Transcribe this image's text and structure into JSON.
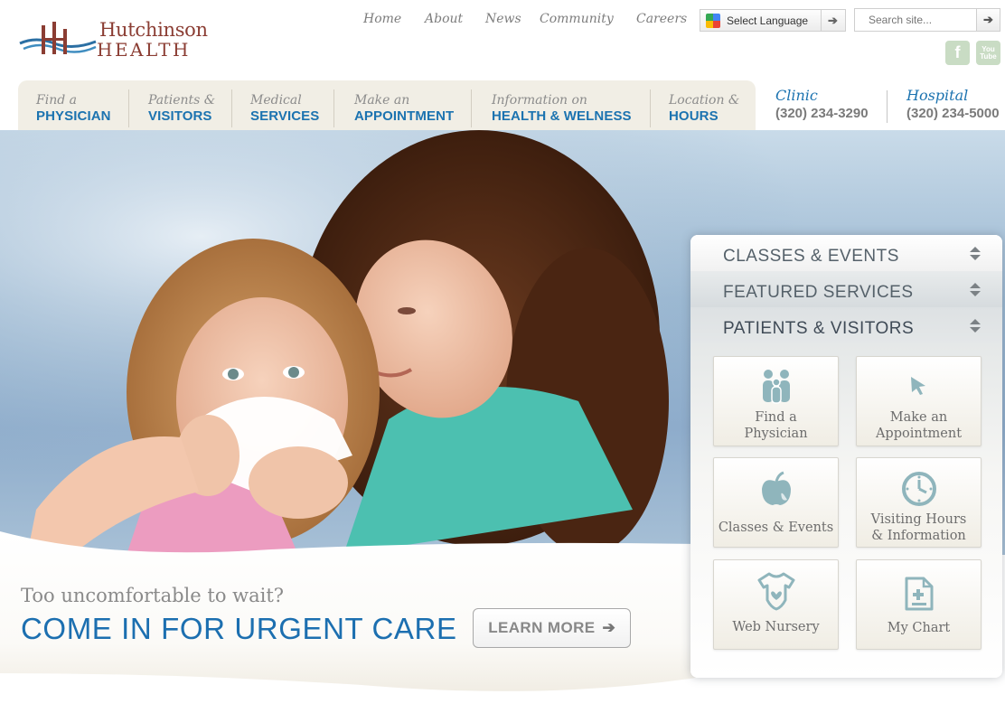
{
  "brand": {
    "name_top": "Hutchinson",
    "name_bottom": "HEALTH"
  },
  "top_nav": [
    "Home",
    "About",
    "News",
    "Community",
    "Careers"
  ],
  "language": {
    "label": "Select Language"
  },
  "search": {
    "placeholder": "Search site..."
  },
  "social": {
    "facebook": "f",
    "youtube_top": "You",
    "youtube_bottom": "Tube"
  },
  "main_nav": [
    {
      "small": "Find a",
      "big": "PHYSICIAN"
    },
    {
      "small": "Patients &",
      "big": "VISITORS"
    },
    {
      "small": "Medical",
      "big": "SERVICES"
    },
    {
      "small": "Make an",
      "big": "APPOINTMENT"
    },
    {
      "small": "Information on",
      "big": "HEALTH & WELNESS"
    },
    {
      "small": "Location &",
      "big": "HOURS"
    }
  ],
  "phones": [
    {
      "label": "Clinic",
      "number": "(320) 234-3290"
    },
    {
      "label": "Hospital",
      "number": "(320) 234-5000"
    }
  ],
  "promo": {
    "question": "Too uncomfortable to wait?",
    "title": "COME IN FOR URGENT CARE",
    "button": "LEARN MORE"
  },
  "panel": {
    "sections": [
      "CLASSES & EVENTS",
      "FEATURED SERVICES",
      "PATIENTS & VISITORS"
    ],
    "tiles": [
      {
        "label_1": "Find a",
        "label_2": "Physician",
        "icon": "people-icon"
      },
      {
        "label_1": "Make an",
        "label_2": "Appointment",
        "icon": "cursor-icon"
      },
      {
        "label_1": "Classes & Events",
        "label_2": "",
        "icon": "apple-icon"
      },
      {
        "label_1": "Visiting Hours",
        "label_2": "& Information",
        "icon": "clock-icon"
      },
      {
        "label_1": "Web Nursery",
        "label_2": "",
        "icon": "onesie-icon"
      },
      {
        "label_1": "My Chart",
        "label_2": "",
        "icon": "document-icon"
      }
    ]
  },
  "colors": {
    "brand_blue": "#1c73b0",
    "brand_red": "#8b3d33",
    "icon_teal": "#8fb5bc",
    "nav_bg": "#f1eee5"
  }
}
